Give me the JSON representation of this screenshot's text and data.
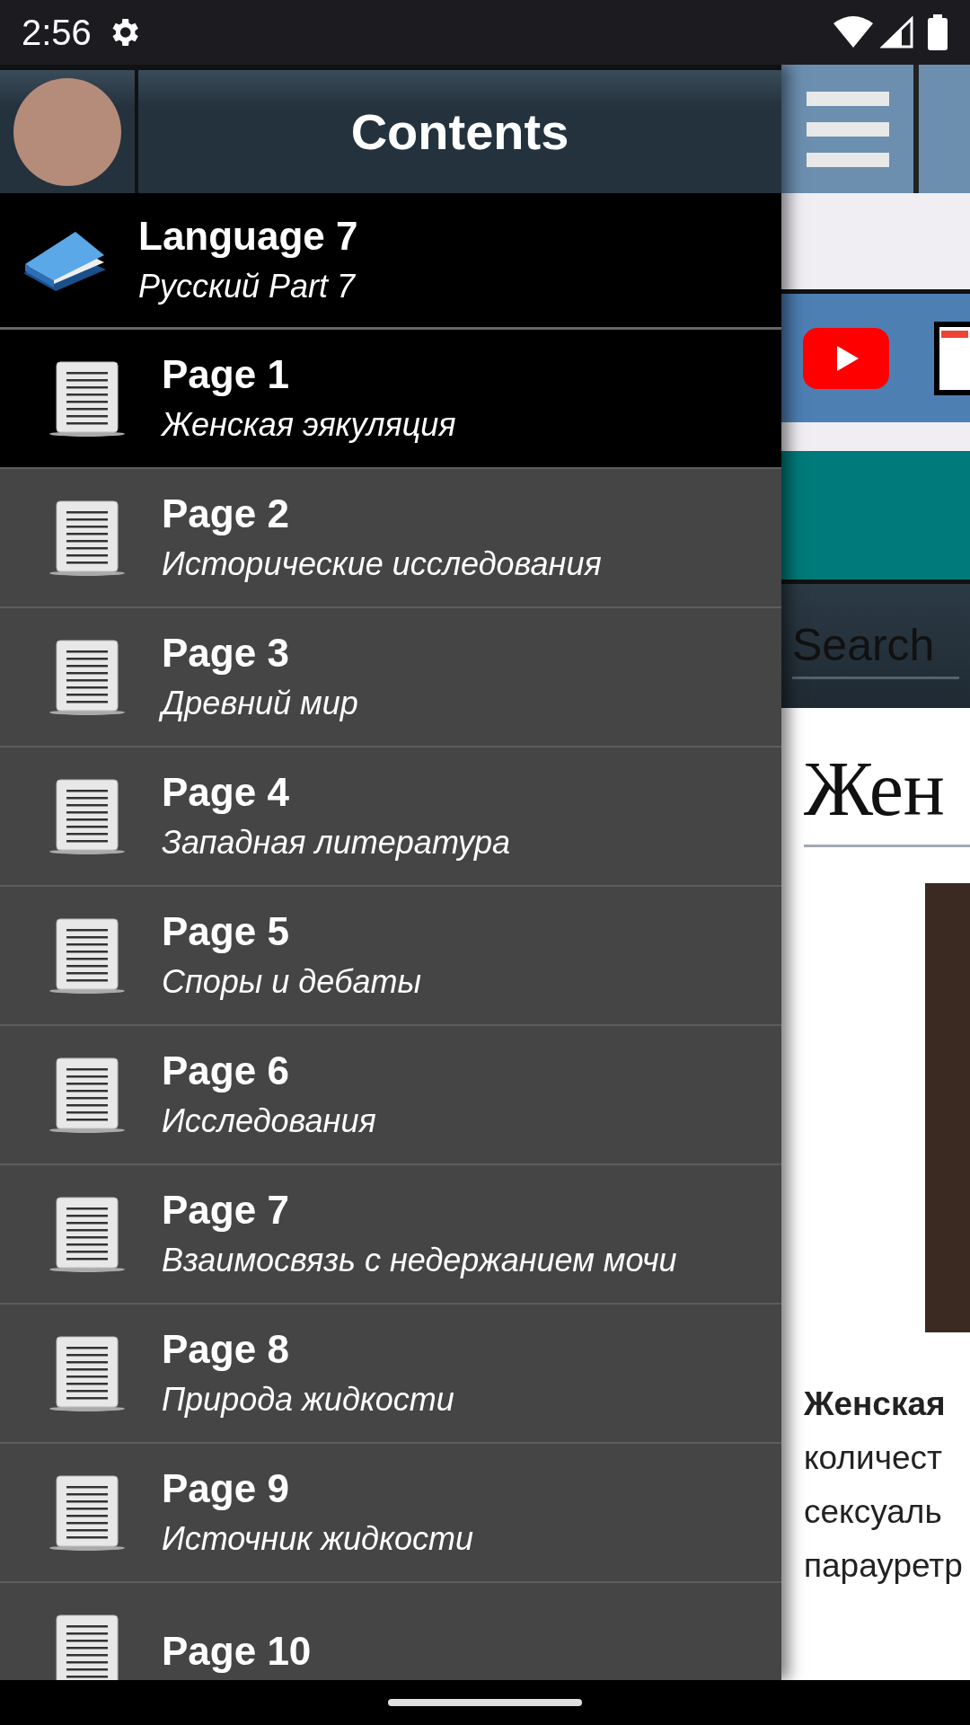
{
  "status_bar": {
    "time": "2:56"
  },
  "drawer": {
    "title": "Contents",
    "language": {
      "title": "Language 7",
      "subtitle": "Русский Part 7"
    },
    "pages": [
      {
        "title": "Page 1",
        "subtitle": "Женская эякуляция",
        "selected": true
      },
      {
        "title": "Page 2",
        "subtitle": "Исторические исследования",
        "selected": false
      },
      {
        "title": "Page 3",
        "subtitle": "Древний мир",
        "selected": false
      },
      {
        "title": "Page 4",
        "subtitle": "Западная литература",
        "selected": false
      },
      {
        "title": "Page 5",
        "subtitle": "Споры и дебаты",
        "selected": false
      },
      {
        "title": "Page 6",
        "subtitle": "Исследования",
        "selected": false
      },
      {
        "title": "Page 7",
        "subtitle": "Взаимосвязь с недержанием мочи",
        "selected": false
      },
      {
        "title": "Page 8",
        "subtitle": "Природа жидкости",
        "selected": false
      },
      {
        "title": "Page 9",
        "subtitle": "Источник жидкости",
        "selected": false
      },
      {
        "title": "Page 10",
        "selected": false
      }
    ]
  },
  "article": {
    "search": {
      "placeholder": "Search"
    },
    "heading": "Жен",
    "lines": [
      "**Женская**",
      "количест",
      "сексуаль",
      "парауретр"
    ]
  }
}
